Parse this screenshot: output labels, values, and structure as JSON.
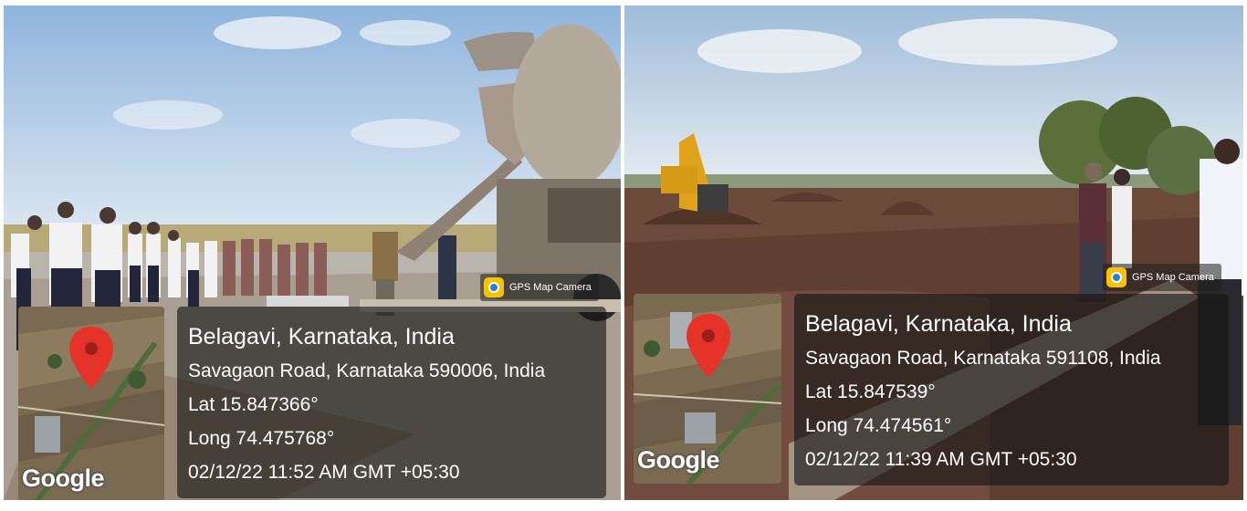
{
  "photos": [
    {
      "gps_badge": "GPS Map Camera",
      "map_logo": "Google",
      "pin_color": "#e5332a",
      "location": "Belagavi, Karnataka, India",
      "address": "Savagaon Road, Karnataka 590006, India",
      "lat": "Lat 15.847366°",
      "long": "Long 74.475768°",
      "datetime": "02/12/22 11:52 AM GMT +05:30"
    },
    {
      "gps_badge": "GPS Map Camera",
      "map_logo": "Google",
      "pin_color": "#e5332a",
      "location": "Belagavi, Karnataka, India",
      "address": "Savagaon Road, Karnataka 591108, India",
      "lat": "Lat 15.847539°",
      "long": "Long 74.474561°",
      "datetime": "02/12/22 11:39 AM GMT +05:30"
    }
  ]
}
